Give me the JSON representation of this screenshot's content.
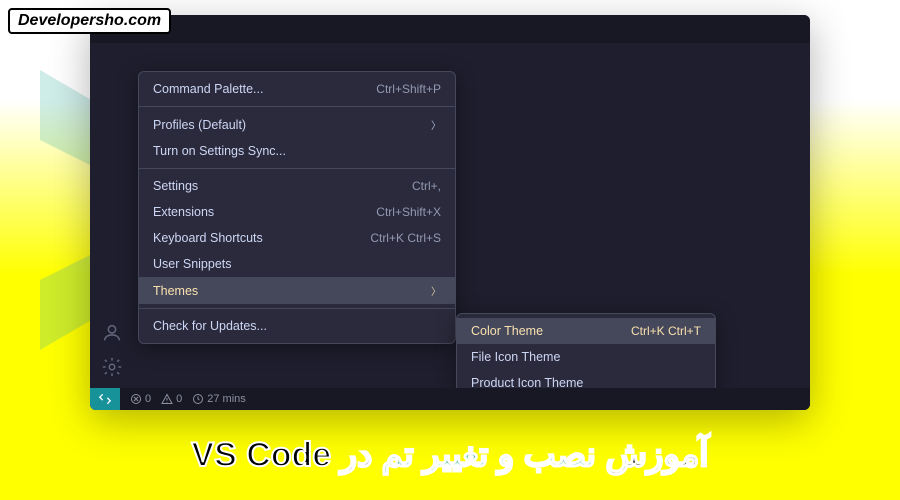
{
  "watermark": "Developersho.com",
  "menu": {
    "command_palette": {
      "label": "Command Palette...",
      "shortcut": "Ctrl+Shift+P"
    },
    "profiles": {
      "label": "Profiles (Default)"
    },
    "settings_sync": {
      "label": "Turn on Settings Sync..."
    },
    "settings": {
      "label": "Settings",
      "shortcut": "Ctrl+,"
    },
    "extensions": {
      "label": "Extensions",
      "shortcut": "Ctrl+Shift+X"
    },
    "keyboard_shortcuts": {
      "label": "Keyboard Shortcuts",
      "shortcut": "Ctrl+K Ctrl+S"
    },
    "user_snippets": {
      "label": "User Snippets"
    },
    "themes": {
      "label": "Themes"
    },
    "check_updates": {
      "label": "Check for Updates..."
    }
  },
  "submenu": {
    "color_theme": {
      "label": "Color Theme",
      "shortcut": "Ctrl+K Ctrl+T"
    },
    "file_icon_theme": {
      "label": "File Icon Theme"
    },
    "product_icon_theme": {
      "label": "Product Icon Theme"
    }
  },
  "status": {
    "errors": "0",
    "warnings": "0",
    "time": "27 mins"
  },
  "caption": {
    "vscode": "VS Code",
    "in_word": "در",
    "theme": "نصب و تغییر تم",
    "tutorial": "آموزش"
  }
}
